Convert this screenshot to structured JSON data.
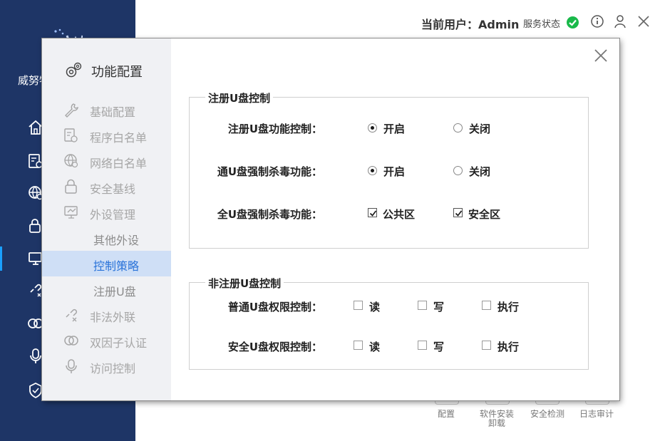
{
  "app": {
    "name": "威努特"
  },
  "header": {
    "user_prefix": "当前用户：",
    "user_name": "Admin",
    "service_status_label": "服务状态",
    "service_status_icon": "check-circle-icon",
    "status_color": "#19b94a"
  },
  "bottom_tools": [
    {
      "label": "配置"
    },
    {
      "label": "软件安装卸载"
    },
    {
      "label": "安全检测"
    },
    {
      "label": "日志审计"
    }
  ],
  "dialog": {
    "title": "功能配置",
    "nav": [
      {
        "label": "基础配置",
        "icon": "wrench-icon"
      },
      {
        "label": "程序白名单",
        "icon": "app-whitelist-icon"
      },
      {
        "label": "网络白名单",
        "icon": "globe-icon"
      },
      {
        "label": "安全基线",
        "icon": "lock-icon"
      },
      {
        "label": "外设管理",
        "icon": "monitor-icon"
      },
      {
        "label": "其他外设"
      },
      {
        "label": "控制策略"
      },
      {
        "label": "注册U盘"
      },
      {
        "label": "非法外联",
        "icon": "broken-link-icon"
      },
      {
        "label": "双因子认证",
        "icon": "two-factor-icon"
      },
      {
        "label": "访问控制",
        "icon": "microphone-icon"
      }
    ],
    "active_nav": "控制策略",
    "accent_color": "#2a73d9",
    "registered": {
      "title": "注册U盘控制",
      "rows": [
        {
          "label": "注册U盘功能控制：",
          "options": [
            {
              "label": "开启",
              "checked": true
            },
            {
              "label": "关闭",
              "checked": false
            }
          ]
        },
        {
          "label": "通U盘强制杀毒功能：",
          "options": [
            {
              "label": "开启",
              "checked": true
            },
            {
              "label": "关闭",
              "checked": false
            }
          ]
        },
        {
          "label": "全U盘强制杀毒功能：",
          "options": [
            {
              "label": "公共区",
              "checked": true
            },
            {
              "label": "安全区",
              "checked": true
            }
          ]
        }
      ]
    },
    "unregistered": {
      "title": "非注册U盘控制",
      "rows": [
        {
          "label": "普通U盘权限控制：",
          "options": [
            {
              "label": "读",
              "checked": false
            },
            {
              "label": "写",
              "checked": false
            },
            {
              "label": "执行",
              "checked": false
            }
          ]
        },
        {
          "label": "安全U盘权限控制：",
          "options": [
            {
              "label": "读",
              "checked": false
            },
            {
              "label": "写",
              "checked": false
            },
            {
              "label": "执行",
              "checked": false
            }
          ]
        }
      ]
    }
  }
}
